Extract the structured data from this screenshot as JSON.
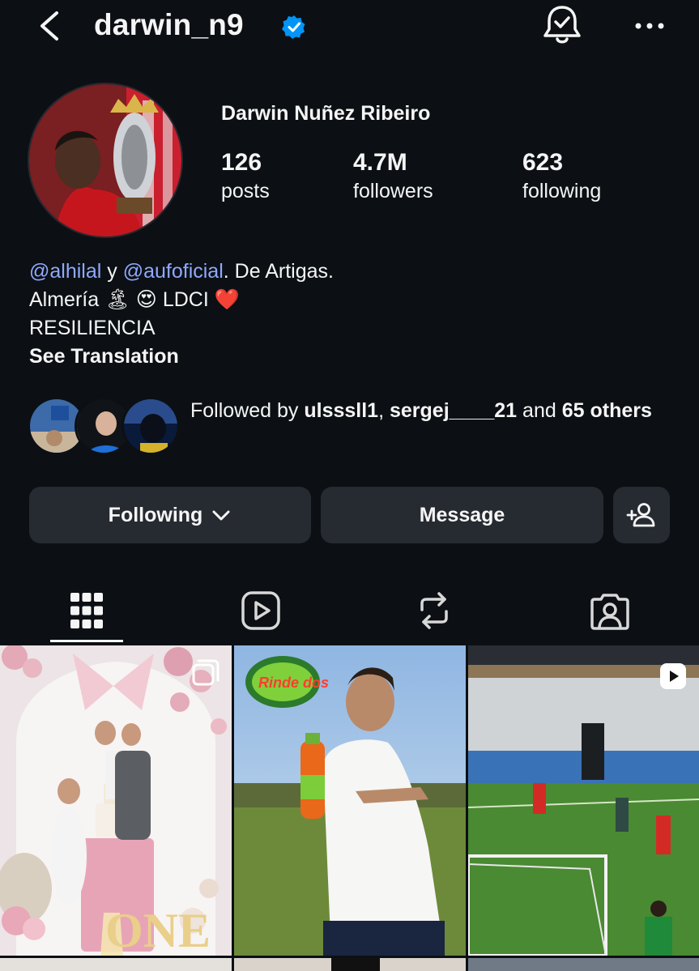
{
  "header": {
    "username": "darwin_n9",
    "back_icon": "chevron-left-icon",
    "verified_icon": "verified-badge-icon",
    "notify_icon": "bell-check-icon",
    "more_icon": "more-horizontal-icon",
    "verified_color": "#0095f6"
  },
  "profile": {
    "full_name": "Darwin Nuñez Ribeiro",
    "stats": [
      {
        "value": "126",
        "label": "posts"
      },
      {
        "value": "4.7M",
        "label": "followers"
      },
      {
        "value": "623",
        "label": "following"
      }
    ]
  },
  "bio": {
    "mention1": "@alhilal",
    "joiner": " y ",
    "mention2": "@aufoficial",
    "line1_rest": ". De Artigas.",
    "line2_text": "Almería",
    "line2_emoji1": "🏝",
    "line2_emoji2": "😍",
    "line2_text2": "LDCI",
    "line2_emoji3": "❤️",
    "line3": "RESILIENCIA",
    "see_translation": "See Translation",
    "mention_color": "#8fa9ff"
  },
  "followed_by": {
    "prefix": "Followed by",
    "user1": "ulsssll1",
    "separator": ",",
    "user2": "sergej____21",
    "middle": "and",
    "count": "65",
    "suffix": "others"
  },
  "actions": {
    "following_label": "Following",
    "message_label": "Message",
    "add_user_icon": "add-person-icon"
  },
  "tabs": [
    {
      "name": "posts-grid-icon",
      "active": true
    },
    {
      "name": "reels-play-icon",
      "active": false
    },
    {
      "name": "reposts-icon",
      "active": false
    },
    {
      "name": "tagged-person-icon",
      "active": false
    }
  ],
  "grid_posts": [
    {
      "description_icon": "carousel-icon",
      "badge": "multiple"
    },
    {
      "badge": "",
      "logo_text": "Rinde dos"
    },
    {
      "badge": "reel"
    }
  ],
  "colors": {
    "background": "#0c1014",
    "button": "#262a31",
    "text": "#f5f5f5"
  }
}
